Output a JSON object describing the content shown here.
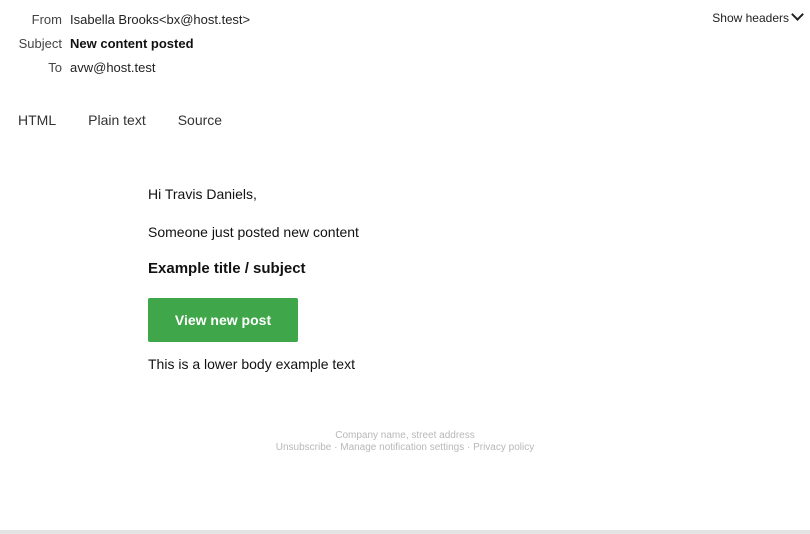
{
  "headers": {
    "from_label": "From",
    "from_value": "Isabella Brooks<bx@host.test>",
    "subject_label": "Subject",
    "subject_value": "New content posted",
    "to_label": "To",
    "to_value": "avw@host.test",
    "show_headers": "Show headers"
  },
  "tabs": [
    {
      "label": "HTML"
    },
    {
      "label": "Plain text"
    },
    {
      "label": "Source"
    }
  ],
  "email": {
    "greeting": "Hi Travis Daniels,",
    "intro": "Someone just posted new content",
    "title": "Example title / subject",
    "button_label": "View new post",
    "lower_text": "This is a lower body example text"
  },
  "footer": {
    "line1": "Company name, street address",
    "line2": "Unsubscribe · Manage notification settings · Privacy policy"
  },
  "colors": {
    "button_bg": "#3fa649",
    "footer_text": "#b8b8b8"
  },
  "icons": {
    "show_headers": "chevron-down-icon"
  }
}
